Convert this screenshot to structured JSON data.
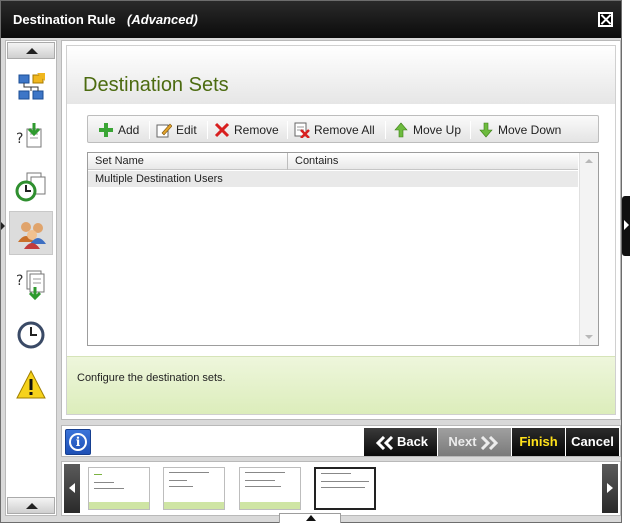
{
  "window": {
    "title": "Destination Rule",
    "subtitle": "(Advanced)"
  },
  "sidebar": {
    "items": [
      {
        "icon": "process-diagram-icon",
        "active": false
      },
      {
        "icon": "question-download-icon",
        "active": false
      },
      {
        "icon": "clock-copy-icon",
        "active": false
      },
      {
        "icon": "users-group-icon",
        "active": true
      },
      {
        "icon": "question-document-download-icon",
        "active": false
      },
      {
        "icon": "clock-icon",
        "active": false
      },
      {
        "icon": "warning-icon",
        "active": false
      }
    ]
  },
  "main": {
    "page_title": "Destination Sets",
    "toolbar": {
      "add": "Add",
      "edit": "Edit",
      "remove": "Remove",
      "remove_all": "Remove All",
      "move_up": "Move Up",
      "move_down": "Move Down"
    },
    "grid": {
      "columns": [
        "Set Name",
        "Contains"
      ],
      "rows": [
        {
          "set_name": "Multiple Destination Users",
          "contains": ""
        }
      ]
    },
    "description": "Configure the destination sets."
  },
  "buttons": {
    "back": "Back",
    "next": "Next",
    "finish": "Finish",
    "cancel": "Cancel"
  },
  "thumbnail_strip": {
    "count": 4,
    "selected_index": 3
  },
  "colors": {
    "title_green": "#4c6b10",
    "finish_yellow": "#ffe11a",
    "description_band": "#dcedbb"
  }
}
